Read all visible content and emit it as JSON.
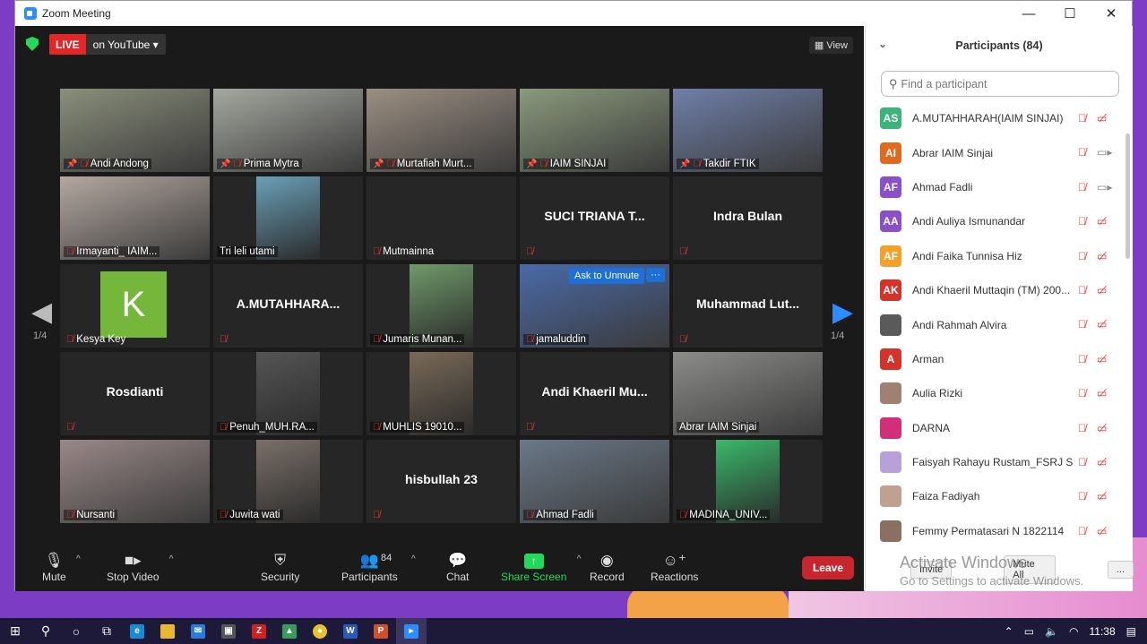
{
  "window": {
    "title": "Zoom Meeting",
    "controls": [
      "—",
      "☐",
      "✕"
    ]
  },
  "topbar": {
    "live_label": "LIVE",
    "stream_label": "on YouTube",
    "view_label": "View"
  },
  "tiles": [
    {
      "name": "Andi Andong",
      "kind": "video",
      "color": "#8a8f7a",
      "pinned": true
    },
    {
      "name": "Prima Mytra",
      "kind": "video",
      "color": "#a5a8a0",
      "pinned": true
    },
    {
      "name": "Murtafiah Murt...",
      "kind": "video",
      "color": "#9c8f82",
      "pinned": true
    },
    {
      "name": "IAIM SINJAI",
      "kind": "video",
      "color": "#8a9a7c",
      "pinned": true,
      "active": true
    },
    {
      "name": "Takdir FTIK",
      "kind": "video",
      "color": "#6f7fa8",
      "pinned": true
    },
    {
      "name": "Irmayanti_ IAIM...",
      "kind": "video",
      "color": "#b4a8a0"
    },
    {
      "name": "Tri leli utami",
      "kind": "video-narrow",
      "color": "#6aa0b8",
      "muted": false
    },
    {
      "name": "Mutmainna",
      "kind": "blank"
    },
    {
      "name": "SUCI TRIANA T...",
      "kind": "nameonly",
      "label": ""
    },
    {
      "name": "Indra Bulan",
      "kind": "nameonly",
      "label": ""
    },
    {
      "name": "Kesya Key",
      "kind": "avatar",
      "letter": "K"
    },
    {
      "name": "A.MUTAHHARA...",
      "kind": "nameonly",
      "label": ""
    },
    {
      "name": "Jumaris Munan...",
      "kind": "video-narrow",
      "color": "#6f9a6a"
    },
    {
      "name": "jamaluddin",
      "kind": "video",
      "color": "#4a6aa8",
      "unmute": true
    },
    {
      "name": "Muhammad Lut...",
      "kind": "nameonly",
      "label": ""
    },
    {
      "name": "Rosdianti",
      "kind": "nameonly",
      "label": ""
    },
    {
      "name": "Penuh_MUH.RA...",
      "kind": "video-narrow",
      "color": "#555555"
    },
    {
      "name": "MUHLIS 19010...",
      "kind": "video-narrow",
      "color": "#7a6a58"
    },
    {
      "name": "Andi Khaeril Mu...",
      "kind": "nameonly",
      "label": ""
    },
    {
      "name": "Abrar IAIM Sinjai",
      "kind": "video",
      "color": "#8c8c8a",
      "muted": false
    },
    {
      "name": "Nursanti",
      "kind": "video",
      "color": "#9a8888"
    },
    {
      "name": "Juwita wati",
      "kind": "video-narrow",
      "color": "#7a7068"
    },
    {
      "name": "hisbullah 23",
      "kind": "nameonly",
      "label": ""
    },
    {
      "name": "Ahmad Fadli",
      "kind": "video",
      "color": "#6a7888"
    },
    {
      "name": "MADINA_UNIV...",
      "kind": "video-narrow",
      "color": "#3ab86a"
    }
  ],
  "unmute": {
    "ask": "Ask to Unmute",
    "more": "···"
  },
  "paging": {
    "left": "1/4",
    "right": "1/4"
  },
  "toolbar": {
    "mute": "Mute",
    "stop_video": "Stop Video",
    "security": "Security",
    "participants": "Participants",
    "participants_count": "84",
    "chat": "Chat",
    "share_screen": "Share Screen",
    "record": "Record",
    "reactions": "Reactions",
    "leave": "Leave"
  },
  "panel": {
    "title": "Participants (84)",
    "search_placeholder": "Find a participant",
    "invite": "Invite",
    "mute_all": "Mute All",
    "more": "...",
    "participants": [
      {
        "initials": "AS",
        "name": "A.MUTAHHARAH(IAIM SINJAI)",
        "color": "#3bb37a",
        "cam_on": false
      },
      {
        "initials": "AI",
        "name": "Abrar IAIM Sinjai",
        "color": "#e06a1f",
        "cam_on": true
      },
      {
        "initials": "AF",
        "name": "Ahmad Fadli",
        "color": "#8b4fc8",
        "cam_on": true
      },
      {
        "initials": "AA",
        "name": "Andi Auliya Ismunandar",
        "color": "#8b4fc8",
        "cam_on": false
      },
      {
        "initials": "AF",
        "name": "Andi Faika Tunnisa Hiz",
        "color": "#f2a22a",
        "cam_on": false
      },
      {
        "initials": "AK",
        "name": "Andi Khaeril Muttaqin (TM) 200...",
        "color": "#d2342c",
        "cam_on": false
      },
      {
        "initials": "",
        "name": "Andi Rahmah Alvira",
        "color": "#5a5a5a",
        "cam_on": false
      },
      {
        "initials": "A",
        "name": "Arman",
        "color": "#d2342c",
        "cam_on": false
      },
      {
        "initials": "",
        "name": "Aulia Rizki",
        "color": "#a08070",
        "cam_on": false
      },
      {
        "initials": "",
        "name": "DARNA",
        "color": "#d0307a",
        "cam_on": false
      },
      {
        "initials": "",
        "name": "Faisyah Rahayu Rustam_FSRJ Si...",
        "color": "#b8a0d8",
        "cam_on": false
      },
      {
        "initials": "",
        "name": "Faiza Fadiyah",
        "color": "#c0a090",
        "cam_on": false
      },
      {
        "initials": "",
        "name": "Femmy Permatasari N 1822114",
        "color": "#8a7060",
        "cam_on": false
      }
    ]
  },
  "activate": {
    "line1": "Activate Windows",
    "line2": "Go to Settings to activate Windows."
  },
  "taskbar": {
    "time": "11:38"
  }
}
